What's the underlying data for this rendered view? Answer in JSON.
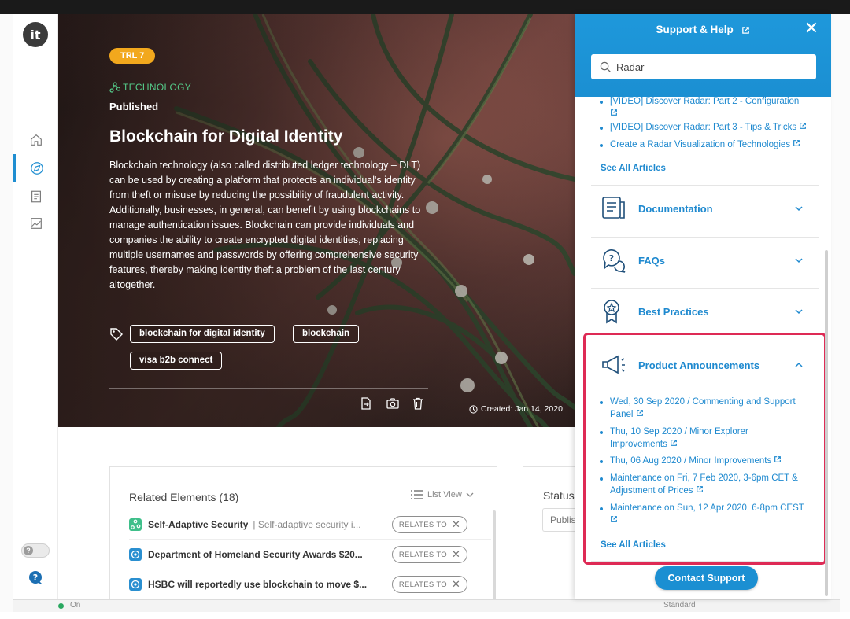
{
  "sidebar": {
    "logo_text": "it",
    "nav_icons": [
      "home-icon",
      "compass-icon",
      "document-icon",
      "image-icon"
    ],
    "toggle_label": "?",
    "help_icon": "help-bubble-icon"
  },
  "hero": {
    "trl": "TRL 7",
    "category": "TECHNOLOGY",
    "status": "Published",
    "title": "Blockchain for Digital Identity",
    "description": "Blockchain technology (also called distributed ledger technology – DLT) can be used by creating a platform that protects an individual's identity from theft or misuse by reducing the possibility of fraudulent activity. Additionally, businesses, in general, can benefit by using blockchains to manage authentication issues. Blockchain can provide individuals and companies the ability to create encrypted digital identities, replacing multiple usernames and passwords by offering comprehensive security features, thereby making identity theft a problem of the last century altogether.",
    "tags": [
      "blockchain for digital identity",
      "blockchain",
      "visa b2b connect"
    ],
    "created": "Created: Jan 14, 2020",
    "colors": {
      "trl_badge": "#f2a81d",
      "category": "#55cc8a"
    }
  },
  "related": {
    "header": "Related Elements (18)",
    "view_label": "List View",
    "relation_label": "RELATES TO",
    "rows": [
      {
        "title": "Self-Adaptive Security",
        "subtitle": "Self-adaptive security i...",
        "icon": "technology-icon",
        "color": "#3fbf8a"
      },
      {
        "title": "Department of Homeland Security Awards $20...",
        "subtitle": "",
        "icon": "trend-icon",
        "color": "#2a8fd0"
      },
      {
        "title": "HSBC will reportedly use blockchain to move $...",
        "subtitle": "",
        "icon": "trend-icon",
        "color": "#2a8fd0"
      }
    ]
  },
  "status": {
    "label": "Status",
    "value": "Publis"
  },
  "bottom_bar": {
    "on_label": "On",
    "standard_label": "Standard"
  },
  "help": {
    "title": "Support & Help",
    "search_value": "Radar",
    "articles": [
      "[VIDEO] Discover Radar: Part 2 - Configuration",
      "[VIDEO] Discover Radar: Part 3 - Tips & Tricks",
      "Create a Radar Visualization of Technologies"
    ],
    "see_all": "See All Articles",
    "sections": [
      {
        "label": "Documentation",
        "icon": "documentation-icon"
      },
      {
        "label": "FAQs",
        "icon": "faq-icon"
      },
      {
        "label": "Best Practices",
        "icon": "award-icon"
      }
    ],
    "announcements": {
      "label": "Product Announcements",
      "items": [
        "Wed, 30 Sep 2020 / Commenting and Support Panel",
        "Thu, 10 Sep 2020 / Minor Explorer Improvements",
        "Thu, 06 Aug 2020 / Minor Improvements",
        "Maintenance on Fri, 7 Feb 2020, 3-6pm CET & Adjustment of Prices",
        "Maintenance on Sun, 12 Apr 2020, 6-8pm CEST"
      ],
      "see_all": "See All Articles"
    },
    "contact": "Contact Support",
    "colors": {
      "header": "#1b8fd2",
      "link": "#1e89cf",
      "highlight": "#de2a55"
    }
  }
}
